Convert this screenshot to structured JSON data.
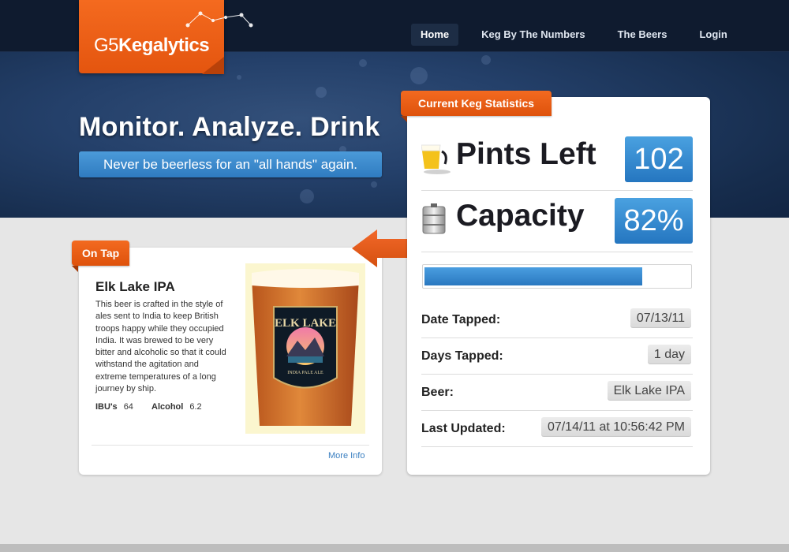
{
  "brand": {
    "prefix": "G5",
    "name": "Kegalytics"
  },
  "nav": [
    {
      "label": "Home",
      "active": true
    },
    {
      "label": "Keg By The Numbers",
      "active": false
    },
    {
      "label": "The Beers",
      "active": false
    },
    {
      "label": "Login",
      "active": false
    }
  ],
  "hero": {
    "headline": "Monitor. Analyze. Drink",
    "tagline": "Never be beerless for an \"all hands\" again."
  },
  "on_tap": {
    "tab_label": "On Tap",
    "beer_name": "Elk Lake IPA",
    "description": "This beer is crafted in the style of ales sent to India to keep British troops happy while they occupied India. It was brewed to be very bitter and alcoholic so that it could withstand the agitation and extreme temperatures of a long journey by ship.",
    "ibu_label": "IBU's",
    "ibu_value": "64",
    "alcohol_label": "Alcohol",
    "alcohol_value": "6.2",
    "more_info": "More Info",
    "glass_text_top": "ELK LAKE",
    "glass_text_bottom": "INDIA PALE ALE"
  },
  "stats": {
    "tab_label": "Current Keg Statistics",
    "pints_left_label": "Pints Left",
    "pints_left_value": "102",
    "capacity_label": "Capacity",
    "capacity_value": "82%",
    "capacity_fraction": 0.82,
    "rows": [
      {
        "key": "Date Tapped:",
        "value": "07/13/11"
      },
      {
        "key": "Days Tapped:",
        "value": "1 day"
      },
      {
        "key": "Beer:",
        "value": "Elk Lake IPA"
      },
      {
        "key": "Last Updated:",
        "value": "07/14/11 at 10:56:42 PM"
      }
    ]
  },
  "colors": {
    "accent_orange": "#f0621a",
    "accent_blue": "#2f80c6",
    "hero_dark": "#162c4c"
  },
  "icons": {
    "pints": "beer-glass-icon",
    "capacity": "keg-icon",
    "arrow": "left-arrow-icon"
  }
}
